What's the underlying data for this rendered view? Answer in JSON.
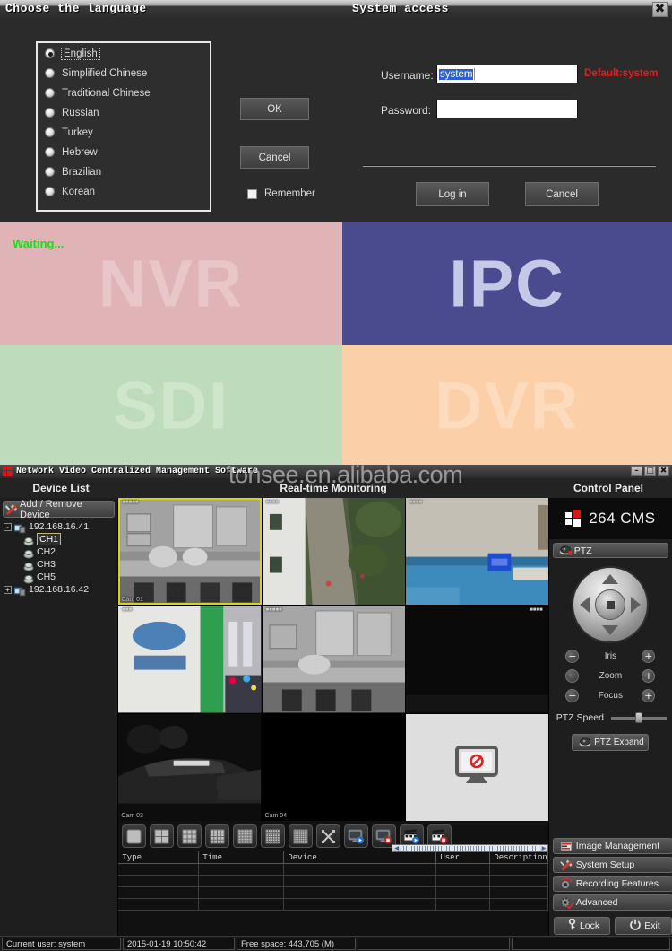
{
  "language_dialog": {
    "title": "Choose the language",
    "options": [
      {
        "label": "English",
        "selected": true
      },
      {
        "label": "Simplified Chinese",
        "selected": false
      },
      {
        "label": "Traditional Chinese",
        "selected": false
      },
      {
        "label": "Russian",
        "selected": false
      },
      {
        "label": "Turkey",
        "selected": false
      },
      {
        "label": "Hebrew",
        "selected": false
      },
      {
        "label": "Brazilian",
        "selected": false
      },
      {
        "label": "Korean",
        "selected": false
      }
    ],
    "ok_label": "OK",
    "cancel_label": "Cancel",
    "remember_label": "Remember"
  },
  "system_access_dialog": {
    "title": "System access",
    "close_icon": "close-icon",
    "username_label": "Username:",
    "username_value": "system",
    "password_label": "Password:",
    "password_value": "",
    "default_hint": "Default:system",
    "login_label": "Log in",
    "cancel_label": "Cancel"
  },
  "quadrants": {
    "waiting_text": "Waiting...",
    "tiles": [
      {
        "label": "NVR",
        "bg": "#e0b4b6",
        "fg": "#e9c6c7"
      },
      {
        "label": "IPC",
        "bg": "#4a4a8e",
        "fg": "#c5c9e8"
      },
      {
        "label": "SDI",
        "bg": "#bedcbc",
        "fg": "#cfe6cd"
      },
      {
        "label": "DVR",
        "bg": "#fbcfa8",
        "fg": "#fddcbe"
      }
    ]
  },
  "cms": {
    "title": "Network Video Centralized Management Software",
    "watermark": "tonsee.en.alibaba.com",
    "window_buttons": [
      "minimize-icon",
      "maximize-icon",
      "close-icon"
    ],
    "headers": {
      "device_list": "Device List",
      "monitoring": "Real-time Monitoring",
      "control_panel": "Control Panel"
    },
    "device_list": {
      "add_remove_label": "Add / Remove Device",
      "nodes": [
        {
          "label": "192.168.16.41",
          "expanded": true,
          "expander": "-",
          "children": [
            {
              "label": "CH1",
              "selected": true
            },
            {
              "label": "CH2",
              "selected": false
            },
            {
              "label": "CH3",
              "selected": false
            },
            {
              "label": "CH5",
              "selected": false
            }
          ]
        },
        {
          "label": "192.168.16.42",
          "expanded": false,
          "expander": "+",
          "children": []
        }
      ]
    },
    "video_grid": {
      "rows": 3,
      "cols": 3,
      "cells": [
        {
          "id": 1,
          "active": true,
          "type": "scene-office-bw",
          "label": "Cam 01",
          "top_label": ""
        },
        {
          "id": 2,
          "active": false,
          "type": "scene-outdoor",
          "label": "",
          "top_label": ""
        },
        {
          "id": 3,
          "active": false,
          "type": "scene-wall",
          "label": "",
          "top_label": ""
        },
        {
          "id": 4,
          "active": false,
          "type": "scene-lobby",
          "label": "",
          "top_label": ""
        },
        {
          "id": 5,
          "active": false,
          "type": "scene-office2-bw",
          "label": "",
          "top_label": ""
        },
        {
          "id": 6,
          "active": false,
          "type": "scene-dark",
          "label": "",
          "top_label": ""
        },
        {
          "id": 7,
          "active": false,
          "type": "scene-car-bw",
          "label": "Cam 03",
          "top_label": ""
        },
        {
          "id": 8,
          "active": false,
          "type": "scene-black",
          "label": "Cam 04",
          "top_label": ""
        },
        {
          "id": 9,
          "active": false,
          "type": "no-signal",
          "label": "",
          "top_label": ""
        }
      ]
    },
    "toolbar_buttons": [
      {
        "name": "layout-1-button",
        "icon": "grid-1"
      },
      {
        "name": "layout-4-button",
        "icon": "grid-4"
      },
      {
        "name": "layout-9-button",
        "icon": "grid-9"
      },
      {
        "name": "layout-16-button",
        "icon": "grid-16"
      },
      {
        "name": "layout-25-button",
        "icon": "grid-25"
      },
      {
        "name": "layout-36-button",
        "icon": "grid-36"
      },
      {
        "name": "layout-64-button",
        "icon": "grid-64"
      },
      {
        "name": "fullscreen-button",
        "icon": "fullscreen"
      },
      {
        "name": "start-all-preview-button",
        "icon": "monitor-play"
      },
      {
        "name": "stop-all-preview-button",
        "icon": "monitor-stop"
      },
      {
        "name": "start-all-record-button",
        "icon": "clapper-play"
      },
      {
        "name": "stop-all-record-button",
        "icon": "clapper-stop"
      }
    ],
    "log_table": {
      "columns": [
        "Type",
        "Time",
        "Device",
        "User",
        "Description"
      ],
      "rows": [
        [
          "",
          "",
          "",
          "",
          ""
        ],
        [
          "",
          "",
          "",
          "",
          ""
        ],
        [
          "",
          "",
          "",
          "",
          ""
        ],
        [
          "",
          "",
          "",
          "",
          ""
        ]
      ]
    },
    "control_panel": {
      "brand": "264 CMS",
      "ptz_label": "PTZ",
      "lens_controls": [
        {
          "label": "Iris",
          "minus": "−",
          "plus": "+"
        },
        {
          "label": "Zoom",
          "minus": "−",
          "plus": "+"
        },
        {
          "label": "Focus",
          "minus": "−",
          "plus": "+"
        }
      ],
      "ptz_speed_label": "PTZ Speed",
      "ptz_speed_value": 50,
      "ptz_expand_label": "PTZ Expand",
      "menu_items": [
        {
          "label": "Image Management",
          "icon": "image-management-icon"
        },
        {
          "label": "System Setup",
          "icon": "system-setup-icon"
        },
        {
          "label": "Recording Features",
          "icon": "recording-features-icon"
        },
        {
          "label": "Advanced",
          "icon": "advanced-icon"
        }
      ],
      "lock_label": "Lock",
      "exit_label": "Exit"
    },
    "status_bar": {
      "current_user": "Current user: system",
      "datetime": "2015-01-19 10:50:42",
      "free_space": "Free space: 443,705 (M)",
      "slot4": "",
      "slot5": ""
    }
  }
}
